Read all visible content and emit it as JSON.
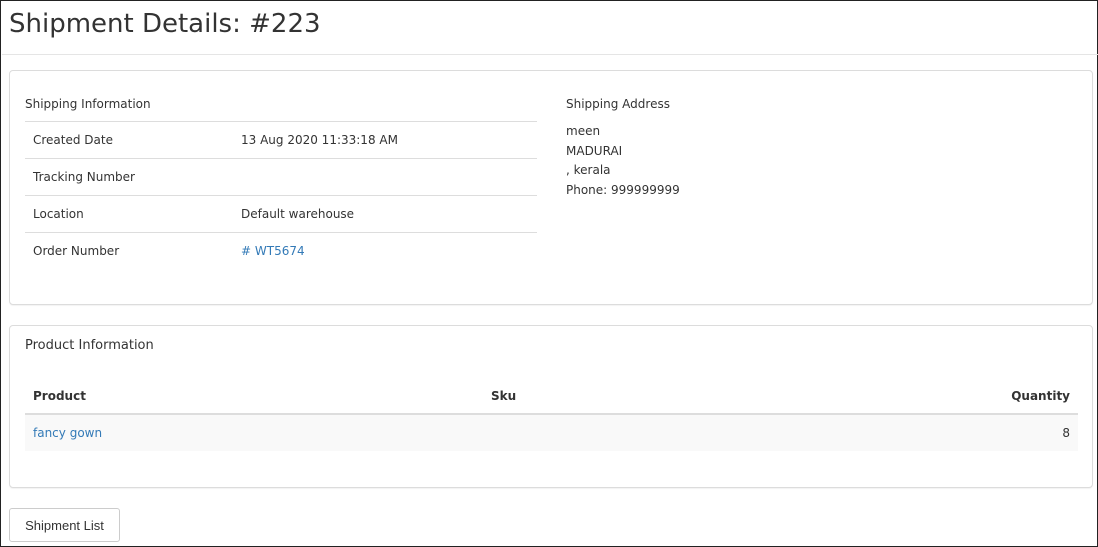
{
  "page": {
    "title": "Shipment Details: #223"
  },
  "shipping_info": {
    "heading": "Shipping Information",
    "rows": [
      {
        "label": "Created Date",
        "value": "13 Aug 2020 11:33:18 AM"
      },
      {
        "label": "Tracking Number",
        "value": ""
      },
      {
        "label": "Location",
        "value": "Default warehouse"
      },
      {
        "label": "Order Number",
        "value": "# WT5674"
      }
    ]
  },
  "shipping_address": {
    "heading": "Shipping Address",
    "lines": [
      "meen",
      "MADURAI",
      ", kerala",
      "Phone: 999999999"
    ]
  },
  "product_info": {
    "heading": "Product Information",
    "columns": {
      "product": "Product",
      "sku": "Sku",
      "quantity": "Quantity"
    },
    "rows": [
      {
        "product": "fancy gown",
        "sku": "",
        "quantity": "8"
      }
    ]
  },
  "actions": {
    "shipment_list_label": "Shipment List"
  },
  "colors": {
    "link": "#337ab7",
    "border": "#dddddd",
    "row_stripe": "#f9f9f9"
  }
}
